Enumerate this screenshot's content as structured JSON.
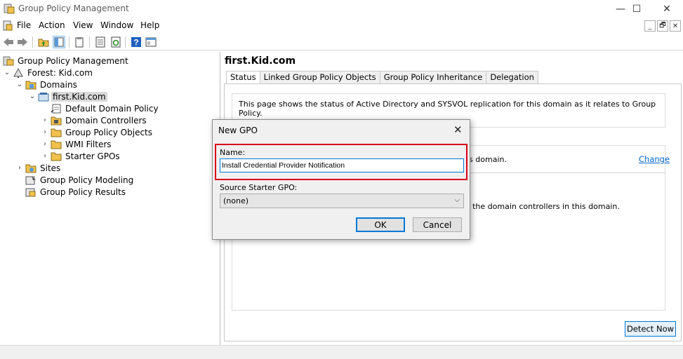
{
  "window": {
    "title": "Group Policy Management",
    "controls": {
      "minimize": "—",
      "maximize": "☐",
      "close": "✕"
    }
  },
  "menu": {
    "items": [
      "File",
      "Action",
      "View",
      "Window",
      "Help"
    ],
    "mdi_controls": {
      "minimize": "_",
      "restore": "🗗",
      "close": "✕"
    }
  },
  "toolbar": {
    "icons": [
      "back-arrow-icon",
      "forward-arrow-icon",
      "folder-up-icon",
      "show-tree-icon",
      "clipboard-icon",
      "properties-icon",
      "refresh-icon",
      "help-icon",
      "console-icon"
    ],
    "help_glyph": "?"
  },
  "tree": {
    "root": "Group Policy Management",
    "forest": "Forest: Kid.com",
    "domains": "Domains",
    "domain": "first.Kid.com",
    "children": [
      "Default Domain Policy",
      "Domain Controllers",
      "Group Policy Objects",
      "WMI Filters",
      "Starter GPOs"
    ],
    "sites": "Sites",
    "modeling": "Group Policy Modeling",
    "results": "Group Policy Results"
  },
  "details": {
    "title": "first.Kid.com",
    "tabs": [
      "Status",
      "Linked Group Policy Objects",
      "Group Policy Inheritance",
      "Delegation"
    ],
    "active_tab": "Status",
    "info_text": "This page shows the status of Active Directory and SYSVOL replication for this domain as it relates to Group Policy.",
    "fragment_1": "is domain.",
    "change_link": "Change",
    "fragment_2": "of the domain controllers in this domain.",
    "detect_button": "Detect Now"
  },
  "dialog": {
    "title": "New GPO",
    "close_glyph": "✕",
    "name_label": "Name:",
    "name_value": "Install Credential Provider Notification",
    "starter_label": "Source Starter GPO:",
    "starter_value": "(none)",
    "dropdown_glyph": "⌵",
    "ok": "OK",
    "cancel": "Cancel"
  },
  "colors": {
    "highlight": "#d9001b",
    "focus": "#0078d7",
    "link": "#0066cc"
  }
}
